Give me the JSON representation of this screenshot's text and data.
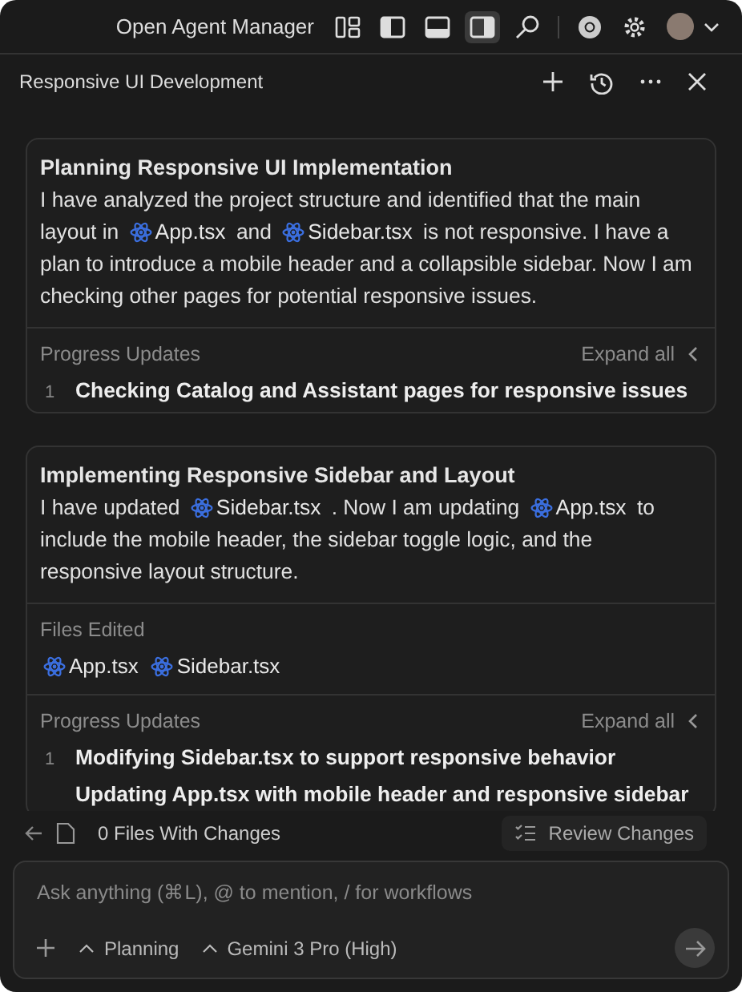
{
  "title_bar": {
    "title": "Open Agent Manager",
    "layout_buttons": [
      {
        "selected": false
      },
      {
        "selected": false
      },
      {
        "selected": false
      },
      {
        "selected": true
      }
    ]
  },
  "panel": {
    "title": "Responsive UI Development"
  },
  "cards": [
    {
      "title": "Planning Responsive UI Implementation",
      "body": [
        {
          "kind": "text",
          "text": "I have analyzed the project structure and identified that the main layout in "
        },
        {
          "kind": "file",
          "text": "App.tsx"
        },
        {
          "kind": "text",
          "text": " and "
        },
        {
          "kind": "file",
          "text": "Sidebar.tsx"
        },
        {
          "kind": "text",
          "text": " is not responsive. I have a plan to introduce a mobile header and a collapsible sidebar. Now I am checking other pages for potential responsive issues."
        }
      ],
      "progress": {
        "label": "Progress Updates",
        "expand": "Expand all",
        "steps": [
          {
            "number": "1",
            "text": "Checking Catalog and Assistant pages for responsive issues"
          }
        ]
      }
    },
    {
      "title": "Implementing Responsive Sidebar and Layout",
      "body": [
        {
          "kind": "text",
          "text": "I have updated "
        },
        {
          "kind": "file",
          "text": "Sidebar.tsx"
        },
        {
          "kind": "text",
          "text": " . Now I am updating "
        },
        {
          "kind": "file",
          "text": "App.tsx"
        },
        {
          "kind": "text",
          "text": " to include the mobile header, the sidebar toggle logic, and the responsive layout structure."
        }
      ],
      "files_edited": {
        "label": "Files Edited",
        "files": [
          "App.tsx",
          "Sidebar.tsx"
        ]
      },
      "progress": {
        "label": "Progress Updates",
        "expand": "Expand all",
        "steps": [
          {
            "number": "1",
            "text": "Modifying Sidebar.tsx to support responsive behavior"
          },
          {
            "text": "Updating App.tsx with mobile header and responsive sidebar"
          }
        ]
      }
    }
  ],
  "changes_bar": {
    "text": "0 Files With Changes",
    "button": "Review Changes"
  },
  "composer": {
    "placeholder": "Ask anything (⌘L), @ to mention, / for workflows",
    "mode": "Planning",
    "model": "Gemini 3 Pro (High)"
  }
}
